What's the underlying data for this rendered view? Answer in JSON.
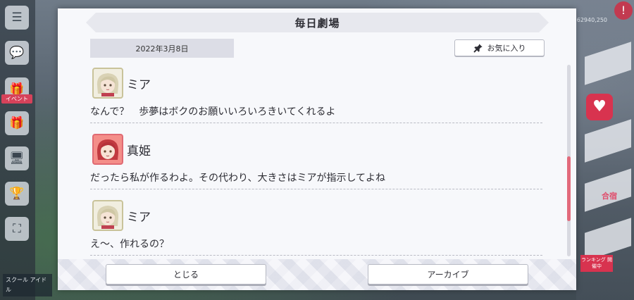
{
  "background": {
    "left_tag": "イベント",
    "bottom_left_text": "スクール アイドル",
    "right_pink_text": "合宿",
    "right_red_badge": "ランキング 開催中",
    "money_text": "62940,250"
  },
  "dialog": {
    "title": "毎日劇場",
    "date": "2022年3月8日",
    "favorite_button_label": "お気に入り",
    "favorite_icon": "pin-icon",
    "messages": [
      {
        "speaker": "ミア",
        "text": "なんで？　歩夢はボクのお願いいろいろきいてくれるよ",
        "avatar": "mia"
      },
      {
        "speaker": "真姫",
        "text": "だったら私が作るわよ。その代わり、大きさはミアが指示してよね",
        "avatar": "maki"
      },
      {
        "speaker": "ミア",
        "text": "え〜、作れるの？",
        "avatar": "mia"
      }
    ],
    "scroll_position": 0.55,
    "close_button_label": "とじる",
    "archive_button_label": "アーカイブ"
  },
  "colors": {
    "accent_scroll": "#e26a7b",
    "dialog_bg": "#f7f8fb",
    "title_bar": "#e7e8ee"
  }
}
